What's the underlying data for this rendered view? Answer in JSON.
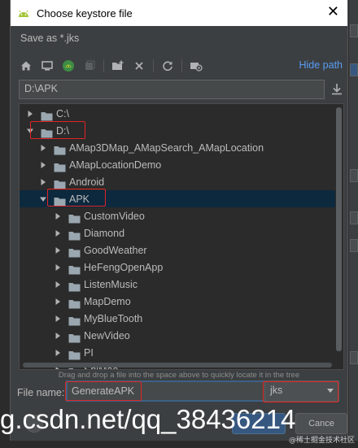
{
  "dialog": {
    "title": "Choose keystore file",
    "subtitle": "Save as *.jks",
    "close_glyph": "✕"
  },
  "toolbar": {
    "icons": [
      "home-icon",
      "desktop-icon",
      "android-project-icon",
      "module-icon",
      "new-folder-icon",
      "delete-icon",
      "refresh-icon",
      "show-hidden-icon"
    ],
    "hide_path_label": "Hide path"
  },
  "path": {
    "value": "D:\\APK"
  },
  "tree": {
    "items": [
      {
        "label": "C:\\",
        "expanded": false
      },
      {
        "label": "D:\\",
        "expanded": true
      },
      {
        "label": "AMap3DMap_AMapSearch_AMapLocation",
        "expanded": false
      },
      {
        "label": "AMapLocationDemo",
        "expanded": false
      },
      {
        "label": "Android",
        "expanded": false
      },
      {
        "label": "APK",
        "expanded": true,
        "selected": true
      },
      {
        "label": "CustomVideo",
        "expanded": false
      },
      {
        "label": "Diamond",
        "expanded": false
      },
      {
        "label": "GoodWeather",
        "expanded": false
      },
      {
        "label": "HeFengOpenApp",
        "expanded": false
      },
      {
        "label": "ListenMusic",
        "expanded": false
      },
      {
        "label": "MapDemo",
        "expanded": false
      },
      {
        "label": "MyBlueTooth",
        "expanded": false
      },
      {
        "label": "NewVideo",
        "expanded": false
      },
      {
        "label": "PI",
        "expanded": false
      },
      {
        "label": "ShiMao",
        "expanded": false
      }
    ]
  },
  "hint": "Drag and drop a file into the space above to quickly locate it in the tree",
  "file": {
    "label": "File name:",
    "value": "GenerateAPK",
    "extension": "jks"
  },
  "buttons": {
    "cancel_label": "Cance"
  },
  "watermark": {
    "text": "g.csdn.net/qq_38436214",
    "secondary": "@稀土掘金技术社区"
  },
  "colors": {
    "accent": "#589df6",
    "selection": "#0d293e",
    "annotation": "#e02424",
    "background": "#3c3f41",
    "tree_background": "#2b2b2b"
  }
}
